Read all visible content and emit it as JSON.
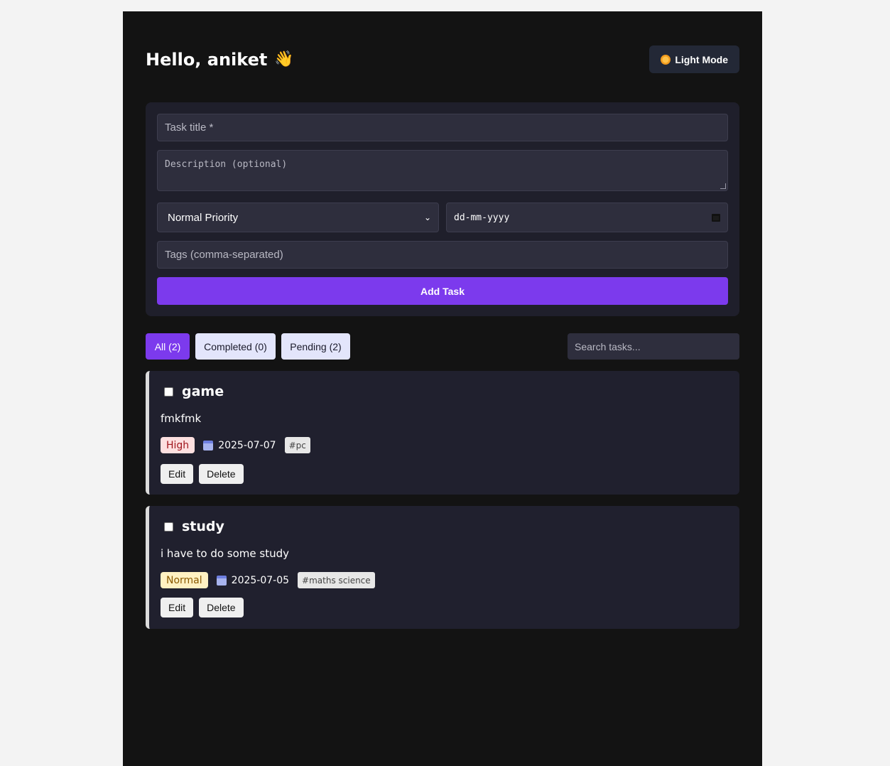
{
  "header": {
    "greeting": "Hello, aniket",
    "wave_emoji": "👋",
    "mode_button_label": "Light Mode",
    "mode_icon": "sun-icon"
  },
  "form": {
    "title_placeholder": "Task title *",
    "description_placeholder": "Description (optional)",
    "priority_selected": "Normal Priority",
    "date_placeholder": "dd-mm-yyyy",
    "tags_placeholder": "Tags (comma-separated)",
    "add_button_label": "Add Task"
  },
  "filters": {
    "all_label": "All (2)",
    "completed_label": "Completed (0)",
    "pending_label": "Pending (2)",
    "search_placeholder": "Search tasks..."
  },
  "tasks": [
    {
      "title": "game",
      "description": "fmkfmk",
      "priority": "High",
      "due_date": "2025-07-07",
      "tag": "#pc",
      "edit_label": "Edit",
      "delete_label": "Delete",
      "completed": false
    },
    {
      "title": "study",
      "description": "i have to do some study",
      "priority": "Normal",
      "due_date": "2025-07-05",
      "tag": "#maths science",
      "edit_label": "Edit",
      "delete_label": "Delete",
      "completed": false
    }
  ],
  "colors": {
    "accent": "#7c3aed",
    "app_background": "#131313",
    "card_background": "#20202e",
    "high_badge": "#fde0e0",
    "normal_badge": "#fff1c2"
  }
}
